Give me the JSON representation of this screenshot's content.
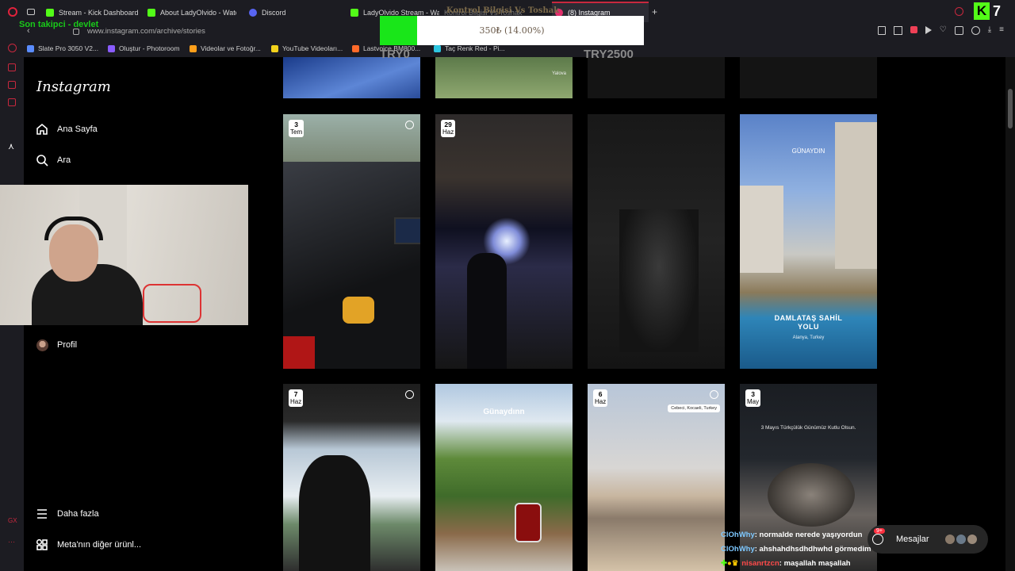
{
  "browser": {
    "tabs": [
      {
        "label": "Stream - Kick Dashboard",
        "icon": "kick-icon",
        "color": "#53fc18"
      },
      {
        "label": "About LadyOlvido - Watc",
        "icon": "kick-icon",
        "color": "#53fc18"
      },
      {
        "label": "Discord",
        "icon": "discord-icon",
        "color": "#5865f2"
      },
      {
        "label": "LadyOlvido Stream - Wat",
        "icon": "kick-icon",
        "color": "#53fc18"
      },
      {
        "label": "Kontrol Bilgisi Vs Toshak",
        "icon": "tab-icon",
        "color": "#c8283e"
      },
      {
        "label": "(8) Instagram",
        "icon": "instagram-icon",
        "color": "#e1306c"
      }
    ],
    "url": "www.instagram.com/archive/stories",
    "bookmarks": [
      {
        "label": "Slate Pro 3050 V2...",
        "icon": "bookmark-icon",
        "color": "#5a8cff"
      },
      {
        "label": "Oluştur - Photoroom",
        "icon": "photoroom-icon",
        "color": "#8a5cff"
      },
      {
        "label": "Videolar ve Fotoğr...",
        "icon": "bookmark-icon",
        "color": "#ff9f1a"
      },
      {
        "label": "YouTube Videoları...",
        "icon": "bookmark-icon",
        "color": "#f2d21b"
      },
      {
        "label": "Lastvoice BM800...",
        "icon": "bookmark-icon",
        "color": "#ff6a2a"
      },
      {
        "label": "Taç Renk Red - Pi...",
        "icon": "bookmark-icon",
        "color": "#2ec6e0"
      }
    ]
  },
  "overlay": {
    "last_follower": "Son takipci - devlet",
    "ticker": "Kontrol Bilgisi Vs Toshak",
    "donation_text": "350₺ (14.00%)",
    "donation_progress": 0.14,
    "goal_left": "TRY0",
    "goal_right": "TRY2500",
    "kick_badge": "7"
  },
  "instagram": {
    "logo": "Instagram",
    "nav": [
      {
        "label": "Ana Sayfa",
        "icon": "home-icon"
      },
      {
        "label": "Ara",
        "icon": "search-icon"
      },
      {
        "label": "Profil",
        "icon": "avatar"
      },
      {
        "label": "Daha fazla",
        "icon": "menu-icon"
      },
      {
        "label": "Meta'nın diğer ürünl...",
        "icon": "apps-icon"
      }
    ],
    "tiles": [
      {
        "day": "3",
        "month": "Tem"
      },
      {
        "day": "29",
        "month": "Haz"
      },
      {
        "day": "7",
        "month": "Haz"
      },
      {
        "day": "6",
        "month": "Haz"
      },
      {
        "day": "3",
        "month": "May"
      }
    ],
    "sticker_gunaydin_1": "GÜNAYDIN",
    "sticker_gunaydin_2": "Günaydınn",
    "location_title": "DAMLATAŞ SAHİL YOLU",
    "location_sub": "Alanya, Turkey",
    "location_tag": "Cebeci, Kocaeli, Turkey",
    "tag_yalova": "Yalova",
    "mayis_text": "3 Mayıs Türkçülük Günümüz Kutlu Olsun.",
    "messages_label": "Mesajlar",
    "messages_badge": "9+"
  },
  "chat": [
    {
      "user": "ClOhWhy",
      "text": ": normalde nerede yaşıyordun",
      "color": "#7ec8ff"
    },
    {
      "user": "ClOhWhy",
      "text": ": ahshahdhsdhdhwhd görmedim",
      "color": "#7ec8ff"
    },
    {
      "user": "nisanrtzcn",
      "text": ": maşallah maşallah",
      "color": "#ff4a4a"
    }
  ]
}
